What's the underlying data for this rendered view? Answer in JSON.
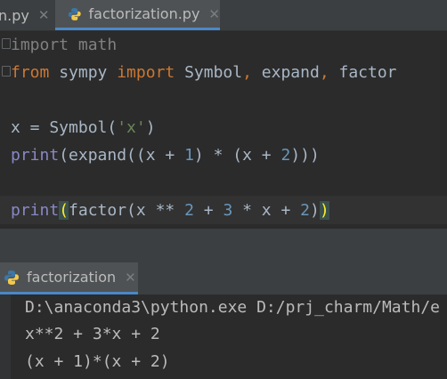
{
  "tabs": [
    {
      "label": "n.py",
      "active": false
    },
    {
      "label": "factorization.py",
      "active": true
    }
  ],
  "editor": {
    "lines": [
      [
        {
          "t": "import math",
          "c": "cm"
        }
      ],
      [
        {
          "t": "from",
          "c": "kw"
        },
        {
          "t": " sympy ",
          "c": "df"
        },
        {
          "t": "import",
          "c": "kw"
        },
        {
          "t": " Symbol",
          "c": "df"
        },
        {
          "t": ",",
          "c": "kw"
        },
        {
          "t": " expand",
          "c": "df"
        },
        {
          "t": ",",
          "c": "kw"
        },
        {
          "t": " factor",
          "c": "df"
        }
      ],
      [],
      [
        {
          "t": "x = Symbol(",
          "c": "df"
        },
        {
          "t": "'x'",
          "c": "str"
        },
        {
          "t": ")",
          "c": "df"
        }
      ],
      [
        {
          "t": "print",
          "c": "fn"
        },
        {
          "t": "(expand((x + ",
          "c": "df"
        },
        {
          "t": "1",
          "c": "num"
        },
        {
          "t": ") * (x + ",
          "c": "df"
        },
        {
          "t": "2",
          "c": "num"
        },
        {
          "t": ")))",
          "c": "df"
        }
      ],
      [],
      [
        {
          "t": "print",
          "c": "fn"
        },
        {
          "t": "(",
          "c": "hl"
        },
        {
          "t": "factor(x ** ",
          "c": "df"
        },
        {
          "t": "2",
          "c": "num"
        },
        {
          "t": " + ",
          "c": "df"
        },
        {
          "t": "3",
          "c": "num"
        },
        {
          "t": " * x + ",
          "c": "df"
        },
        {
          "t": "2",
          "c": "num"
        },
        {
          "t": ")",
          "c": "df"
        },
        {
          "t": ")",
          "c": "hl"
        }
      ]
    ]
  },
  "run": {
    "tab_label": "factorization",
    "output": [
      "D:\\anaconda3\\python.exe D:/prj_charm/Math/e",
      "x**2 + 3*x + 2",
      "(x + 1)*(x + 2)"
    ]
  },
  "colors": {
    "keyword": "#cc7832",
    "builtin": "#8888c6",
    "number": "#6897bb",
    "string": "#6a8759",
    "brace_match": "#ffef28"
  },
  "icons": {
    "file": "python-icon",
    "close": "close-icon"
  }
}
